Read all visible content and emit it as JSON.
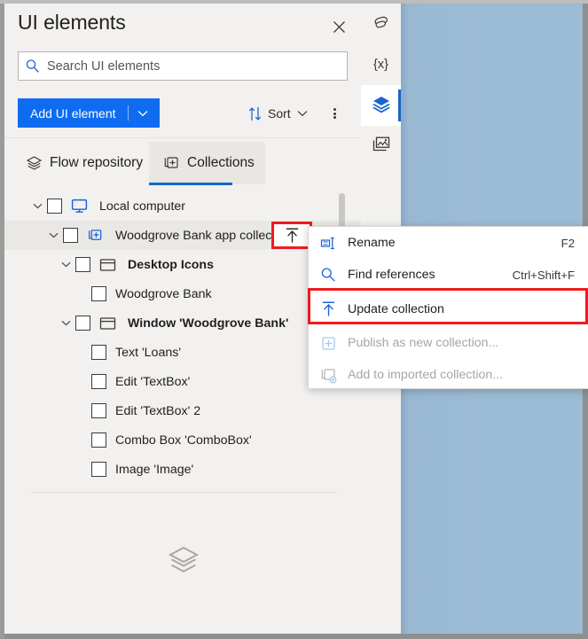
{
  "panel": {
    "title": "UI elements",
    "close_icon": "close-icon"
  },
  "search": {
    "placeholder": "Search UI elements",
    "value": "",
    "icon": "search-icon"
  },
  "toolbar": {
    "add_label": "Add UI element",
    "add_caret_icon": "chevron-down-icon",
    "sort_label": "Sort",
    "sort_icon": "sort-arrows-icon",
    "sort_caret_icon": "chevron-down-icon",
    "more_icon": "more-vertical-icon"
  },
  "tabs": [
    {
      "label": "Flow repository",
      "icon": "layers-icon",
      "selected": false
    },
    {
      "label": "Collections",
      "icon": "collection-add-icon",
      "selected": true
    }
  ],
  "tree": [
    {
      "label": "Local computer",
      "icon": "monitor-icon",
      "indent": 0,
      "bold": false,
      "expanded": true,
      "has_chevron": true,
      "has_checkbox": true,
      "selected": false
    },
    {
      "label": "Woodgrove Bank app collection",
      "icon": "collection-add-icon",
      "indent": 1,
      "bold": false,
      "expanded": true,
      "has_chevron": true,
      "has_checkbox": true,
      "selected": true
    },
    {
      "label": "Desktop Icons",
      "icon": "window-icon",
      "indent": 2,
      "bold": true,
      "expanded": true,
      "has_chevron": true,
      "has_checkbox": true,
      "selected": false
    },
    {
      "label": "Woodgrove Bank",
      "icon": "",
      "indent": 3,
      "bold": false,
      "expanded": false,
      "has_chevron": false,
      "has_checkbox": true,
      "selected": false
    },
    {
      "label": "Window 'Woodgrove Bank'",
      "icon": "window-icon",
      "indent": 2,
      "bold": true,
      "expanded": true,
      "has_chevron": true,
      "has_checkbox": true,
      "selected": false
    },
    {
      "label": "Text 'Loans'",
      "icon": "",
      "indent": 3,
      "bold": false,
      "expanded": false,
      "has_chevron": false,
      "has_checkbox": true,
      "selected": false
    },
    {
      "label": "Edit 'TextBox'",
      "icon": "",
      "indent": 3,
      "bold": false,
      "expanded": false,
      "has_chevron": false,
      "has_checkbox": true,
      "selected": false
    },
    {
      "label": "Edit 'TextBox' 2",
      "icon": "",
      "indent": 3,
      "bold": false,
      "expanded": false,
      "has_chevron": false,
      "has_checkbox": true,
      "selected": false
    },
    {
      "label": "Combo Box 'ComboBox'",
      "icon": "",
      "indent": 3,
      "bold": false,
      "expanded": false,
      "has_chevron": false,
      "has_checkbox": true,
      "selected": false
    },
    {
      "label": "Image 'Image'",
      "icon": "",
      "indent": 3,
      "bold": false,
      "expanded": false,
      "has_chevron": false,
      "has_checkbox": true,
      "selected": false
    }
  ],
  "row_action": {
    "name": "update-collection-button",
    "icon": "upload-arrow-icon",
    "highlighted": true
  },
  "context_menu": [
    {
      "label": "Rename",
      "shortcut": "F2",
      "icon": "rename-icon",
      "disabled": false,
      "highlighted": false
    },
    {
      "label": "Find references",
      "shortcut": "Ctrl+Shift+F",
      "icon": "magnifier-icon",
      "disabled": false,
      "highlighted": false
    },
    {
      "label": "Update collection",
      "shortcut": "",
      "icon": "upload-arrow-icon",
      "disabled": false,
      "highlighted": true
    },
    {
      "label": "Publish as new collection...",
      "shortcut": "",
      "icon": "plus-box-icon",
      "disabled": true,
      "highlighted": false
    },
    {
      "label": "Add to imported collection...",
      "shortcut": "",
      "icon": "collection-add-icon",
      "disabled": true,
      "highlighted": false
    }
  ],
  "rail": [
    {
      "name": "subflows",
      "icon": "subflow-icon",
      "active": false
    },
    {
      "name": "variables",
      "icon": "variables-braces-icon",
      "glyph": "{x}",
      "active": false
    },
    {
      "name": "ui-elements",
      "icon": "layers-icon",
      "active": true
    },
    {
      "name": "images",
      "icon": "images-icon",
      "active": false
    }
  ],
  "watermark": {
    "icon": "layers-icon"
  },
  "colors": {
    "accent_blue": "#0f6cf0",
    "tab_underline": "#1466c8",
    "highlight_red": "#ee1b20",
    "panel_bg": "#f2f1ef",
    "backdrop_blue": "#9cbbd4"
  }
}
